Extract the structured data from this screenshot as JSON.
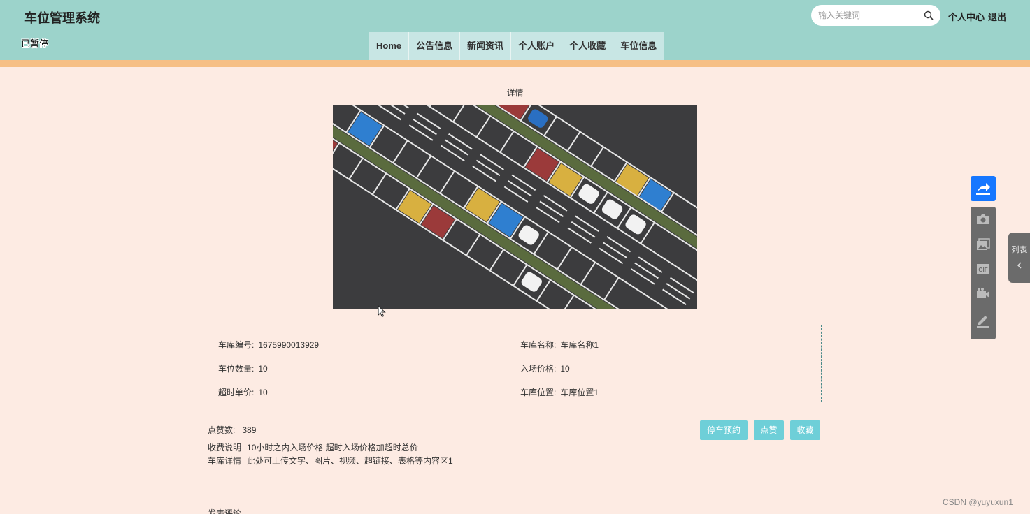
{
  "header": {
    "site_title": "车位管理系统",
    "paused_text": "已暂停",
    "search_placeholder": "输入关键词",
    "personal_center": "个人中心",
    "logout": "退出"
  },
  "nav": {
    "items": [
      "Home",
      "公告信息",
      "新闻资讯",
      "个人账户",
      "个人收藏",
      "车位信息"
    ]
  },
  "detail": {
    "section_label": "详情",
    "info": {
      "garage_no_label": "车库编号:",
      "garage_no": "1675990013929",
      "garage_name_label": "车库名称:",
      "garage_name": "车库名称1",
      "space_count_label": "车位数量:",
      "space_count": "10",
      "entry_price_label": "入场价格:",
      "entry_price": "10",
      "overtime_price_label": "超时单价:",
      "overtime_price": "10",
      "location_label": "车库位置:",
      "location": "车库位置1"
    },
    "likes_label": "点赞数:",
    "likes": "389",
    "fee_label": "收费说明",
    "fee_text": "10小时之内入场价格 超时入场价格加超时总价",
    "garage_detail_label": "车库详情",
    "garage_detail_text": "此处可上传文字、图片、视频、超链接、表格等内容区1",
    "buttons": {
      "reserve": "停车预约",
      "like": "点赞",
      "favorite": "收藏"
    },
    "comment_title": "发表评论"
  },
  "sidebar": {
    "list_tab": "列表",
    "icons": [
      "share-icon",
      "camera-icon",
      "image-icon",
      "gif-icon",
      "video-icon",
      "pen-icon"
    ]
  },
  "watermark": "CSDN @yuyuxun1",
  "colors": {
    "header_bg": "#9cd3cb",
    "stripe": "#f6bf85",
    "page_bg": "#fdebe3",
    "button_bg": "#6ecfd8",
    "share_blue": "#1677ff"
  }
}
